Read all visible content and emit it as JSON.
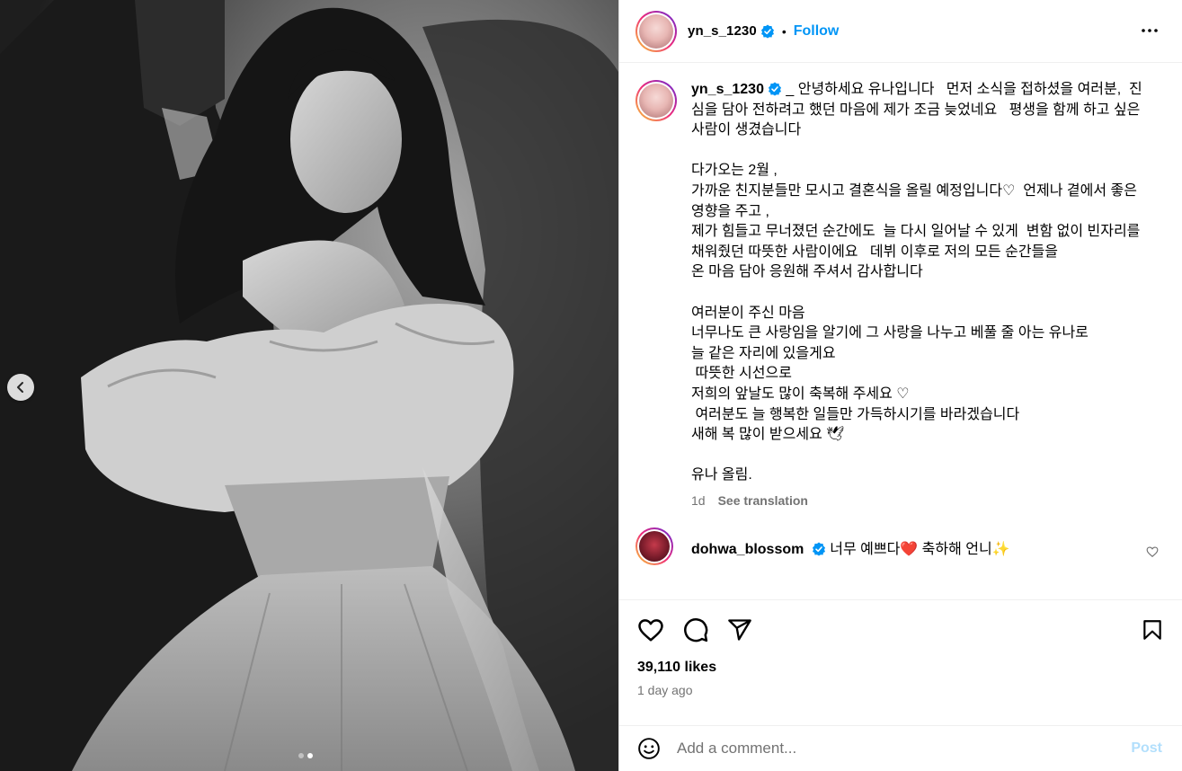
{
  "post": {
    "username": "yn_s_1230",
    "follow_label": "Follow",
    "separator": "•",
    "carousel": {
      "slide_count": 2,
      "active_index": 1
    }
  },
  "caption": {
    "username": "yn_s_1230",
    "text": "_ 안녕하세요 유나입니다   먼저 소식을 접하셨을 여러분,  진심을 담아 전하려고 했던 마음에 제가 조금 늦었네요   평생을 함께 하고 싶은 사람이 생겼습니다\n\n다가오는 2월 ,\n가까운 친지분들만 모시고 결혼식을 올릴 예정입니다♡  언제나 곁에서 좋은 영향을 주고 ,\n제가 힘들고 무너졌던 순간에도  늘 다시 일어날 수 있게  변함 없이 빈자리를 채워줬던 따뜻한 사람이에요   데뷔 이후로 저의 모든 순간들을\n온 마음 담아 응원해 주셔서 감사합니다\n\n여러분이 주신 마음\n너무나도 큰 사랑임을 알기에 그 사랑을 나누고 베풀 줄 아는 유나로\n늘 같은 자리에 있을게요\n 따뜻한 시선으로\n저희의 앞날도 많이 축복해 주세요 ♡\n 여러분도 늘 행복한 일들만 가득하시기를 바라겠습니다\n새해 복 많이 받으세요 🕊\n\n유나 올림.",
    "time": "1d",
    "see_translation": "See translation"
  },
  "comments": [
    {
      "username": "dohwa_blossom",
      "text": "너무 예쁘다❤️ 축하해 언니✨"
    }
  ],
  "engagement": {
    "likes": "39,110 likes",
    "date": "1 day ago"
  },
  "add_comment": {
    "placeholder": "Add a comment...",
    "post_label": "Post"
  },
  "icons": {
    "more": "more-horizontal-icon",
    "verified": "verified-badge-icon",
    "like": "heart-icon",
    "comment": "comment-icon",
    "share": "share-icon",
    "save": "bookmark-icon",
    "emoji": "emoji-icon",
    "prev": "chevron-left-icon"
  },
  "colors": {
    "accent": "#0095f6",
    "verified": "#0095f6",
    "post_disabled": "#b2dffc"
  }
}
